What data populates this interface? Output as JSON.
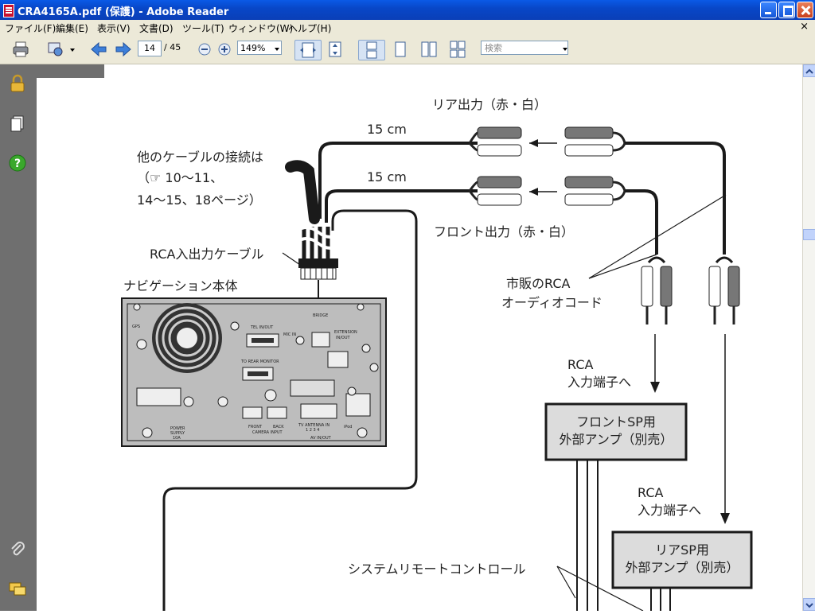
{
  "window": {
    "title": "CRA4165A.pdf (保護) - Adobe Reader",
    "doc_close": "×"
  },
  "menu": [
    "ファイル(F)",
    "編集(E)",
    "表示(V)",
    "文書(D)",
    "ツール(T)",
    "ウィンドウ(W)",
    "ヘルプ(H)"
  ],
  "toolbar": {
    "page_current": "14",
    "page_total": "/ 45",
    "zoom": "149%",
    "search_placeholder": "検索"
  },
  "diagram": {
    "rear_output": "リア出力（赤・白）",
    "front_output": "フロント出力（赤・白）",
    "len_top": "15 cm",
    "len_bottom": "15 cm",
    "other_cables_1": "他のケーブルの接続は",
    "other_cables_2": "（☞ 10〜11、",
    "other_cables_3": "14〜15、18ページ）",
    "rca_cable": "RCA入出力ケーブル",
    "nav_unit": "ナビゲーション本体",
    "commercial_rca_1": "市販のRCA",
    "commercial_rca_2": "オーディオコード",
    "rca_input_1a": "RCA",
    "rca_input_1b": "入力端子へ",
    "rca_input_2a": "RCA",
    "rca_input_2b": "入力端子へ",
    "front_amp_1": "フロントSP用",
    "front_amp_2": "外部アンプ（別売）",
    "rear_amp_1": "リアSP用",
    "rear_amp_2": "外部アンプ（別売）",
    "system_remote": "システムリモートコントロール",
    "unit_labels": {
      "gps": "GPS",
      "tel": "TEL IN/OUT",
      "micin": "MIC IN",
      "bridge": "BRIDGE",
      "extension": "EXTENSION",
      "extension2": "IN/OUT",
      "rearmonitor": "TO REAR MONITOR",
      "power": "POWER",
      "supply": "SUPPLY",
      "amp10": "10A",
      "front": "FRONT",
      "back": "BACK",
      "camera": "CAMERA INPUT",
      "tvantenna": "TV ANTENNA IN",
      "nums": "1 2 3 4",
      "avin": "AV IN/OUT",
      "ipod": "iPod"
    }
  }
}
